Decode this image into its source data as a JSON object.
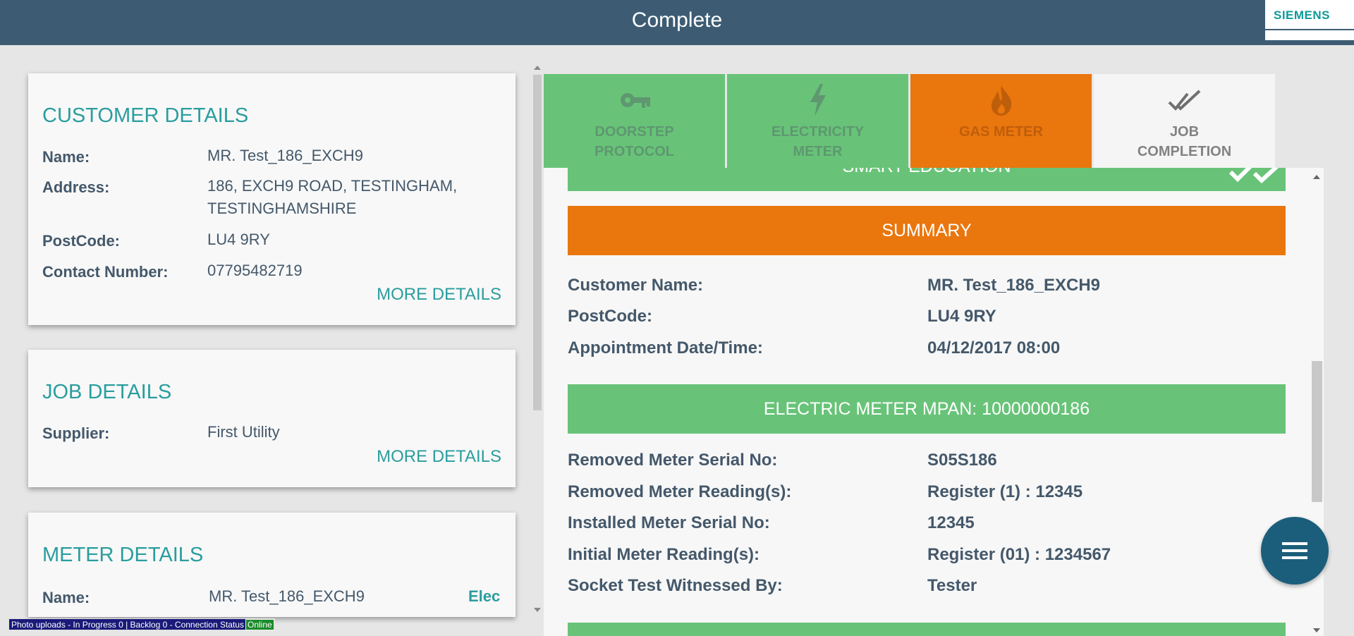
{
  "header": {
    "title": "Complete",
    "brand": "SIEMENS"
  },
  "customer": {
    "heading": "CUSTOMER DETAILS",
    "rows": [
      {
        "label": "Name:",
        "value": "MR. Test_186_EXCH9"
      },
      {
        "label": "Address:",
        "value": "186, EXCH9 ROAD, TESTINGHAM, TESTINGHAMSHIRE"
      },
      {
        "label": "PostCode:",
        "value": "LU4 9RY"
      },
      {
        "label": "Contact Number:",
        "value": "07795482719"
      }
    ],
    "more": "MORE DETAILS"
  },
  "job": {
    "heading": "JOB DETAILS",
    "rows": [
      {
        "label": "Supplier:",
        "value": "First Utility"
      }
    ],
    "more": "MORE DETAILS"
  },
  "meter": {
    "heading": "METER DETAILS",
    "rows": [
      {
        "label": "Name:",
        "value": "MR. Test_186_EXCH9",
        "type": "Elec"
      }
    ]
  },
  "tabs": [
    {
      "line1": "DOORSTEP",
      "line2": "PROTOCOL",
      "icon": "key-icon",
      "state": "done"
    },
    {
      "line1": "ELECTRICITY",
      "line2": "METER",
      "icon": "lightning-icon",
      "state": "done"
    },
    {
      "line1": "GAS METER",
      "line2": "",
      "icon": "flame-icon",
      "state": "active"
    },
    {
      "line1": "JOB",
      "line2": "COMPLETION",
      "icon": "double-check-icon",
      "state": "current"
    }
  ],
  "summary": {
    "top_band": "SMART EDUCATION",
    "title": "SUMMARY",
    "rows": [
      {
        "label": "Customer Name:",
        "value": "MR. Test_186_EXCH9"
      },
      {
        "label": "PostCode:",
        "value": "LU4 9RY"
      },
      {
        "label": "Appointment Date/Time:",
        "value": "04/12/2017 08:00"
      }
    ],
    "electric_band": "ELECTRIC METER MPAN: 10000000186",
    "electric_rows": [
      {
        "label": "Removed Meter Serial No:",
        "value": "S05S186"
      },
      {
        "label": "Removed Meter Reading(s):",
        "value": "Register (1) : 12345"
      },
      {
        "label": "Installed Meter Serial No:",
        "value": "12345"
      },
      {
        "label": "Initial Meter Reading(s):",
        "value": "Register (01) : 1234567"
      },
      {
        "label": "Socket Test Witnessed By:",
        "value": "Tester"
      }
    ]
  },
  "status": {
    "text": "Photo uploads - In Progress 0 | Backlog 0 - Connection Status",
    "connection": "Online"
  },
  "colors": {
    "header": "#3d5c74",
    "accent": "#2a9d9e",
    "green": "#68c378",
    "orange": "#ea760e",
    "fab": "#1b5e7b"
  }
}
